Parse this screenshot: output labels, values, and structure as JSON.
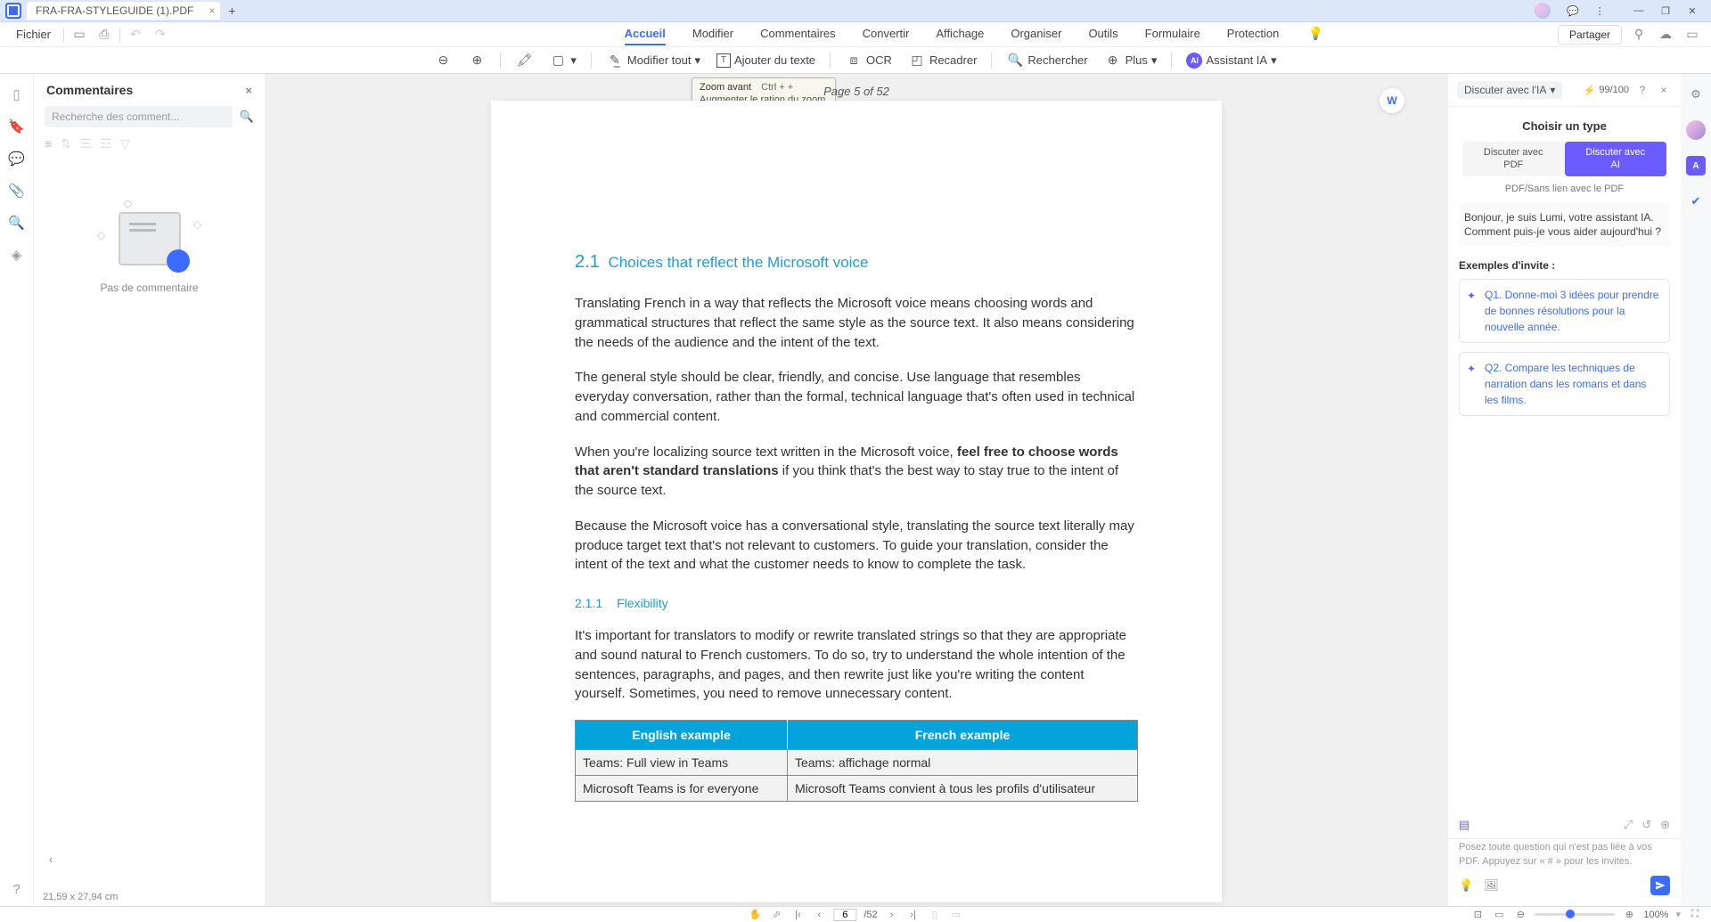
{
  "titlebar": {
    "tab_name": "FRA-FRA-STYLEGUIDE (1).PDF"
  },
  "menubar": {
    "file": "Fichier",
    "tabs": [
      "Accueil",
      "Modifier",
      "Commentaires",
      "Convertir",
      "Affichage",
      "Organiser",
      "Outils",
      "Formulaire",
      "Protection"
    ],
    "share": "Partager"
  },
  "toolbar": {
    "edit_all": "Modifier tout",
    "add_text": "Ajouter du texte",
    "ocr": "OCR",
    "recrop": "Recadrer",
    "search": "Rechercher",
    "more": "Plus",
    "ai": "Assistant IA"
  },
  "tooltip": {
    "title": "Zoom avant",
    "shortcut": "Ctrl + +",
    "desc": "Augmenter le ration du zoom."
  },
  "comments": {
    "title": "Commentaires",
    "search_placeholder": "Recherche des comment...",
    "empty": "Pas de commentaire",
    "dimensions": "21,59 x 27,94 cm"
  },
  "doc": {
    "page_indicator": "Page 5 of 52",
    "section_num": "2.1",
    "section_title": "Choices that reflect the Microsoft voice",
    "p1": "Translating French in a way that reflects the Microsoft voice means choosing words and grammatical structures that reflect the same style as the source text. It also means considering the needs of the audience and the intent of the text.",
    "p2": "The general style should be clear, friendly, and concise. Use language that resembles everyday conversation, rather than the formal, technical language that's often used in technical and commercial content.",
    "p3a": "When you're localizing source text written in the Microsoft voice, ",
    "p3b": "feel free to choose words that aren't standard translations",
    "p3c": " if you think that's the best way to stay true to the intent of the source text.",
    "p4": "Because the Microsoft voice has a conversational style, translating the source text literally may produce target text that's not relevant to customers. To guide your translation, consider the intent of the text and what the customer needs to know to complete the task.",
    "subsec_num": "2.1.1",
    "subsec_title": "Flexibility",
    "p5": "It's important for translators to modify or rewrite translated strings so that they are appropriate and sound natural to French customers. To do so, try to understand the whole intention of the sentences, paragraphs, and pages, and then rewrite just like you're writing the content yourself. Sometimes, you need to remove unnecessary content.",
    "th1": "English example",
    "th2": "French example",
    "r1c1": "Teams: Full view in Teams",
    "r1c2": "Teams: affichage normal",
    "r2c1": "Microsoft Teams is for everyone",
    "r2c2": "Microsoft Teams convient à tous les profils d'utilisateur"
  },
  "ai": {
    "selector": "Discuter avec l'IA",
    "credits": "99/100",
    "choose": "Choisir un type",
    "btn_pdf_l1": "Discuter avec",
    "btn_pdf_l2": "PDF",
    "btn_ai_l1": "Discuter avec",
    "btn_ai_l2": "AI",
    "note": "PDF/Sans lien avec le PDF",
    "greeting": "Bonjour, je suis Lumi, votre assistant IA. Comment puis-je vous aider aujourd'hui ?",
    "examples_title": "Exemples d'invite :",
    "ex1": "Q1. Donne-moi 3 idées pour prendre de bonnes résolutions pour la nouvelle année.",
    "ex2": "Q2. Compare les techniques de narration dans les romans et dans les films.",
    "placeholder": "Posez toute question qui n'est pas liée à vos PDF. Appuyez sur « # » pour les invites."
  },
  "statusbar": {
    "current_page": "6",
    "total_pages": "/52",
    "zoom": "100%"
  }
}
